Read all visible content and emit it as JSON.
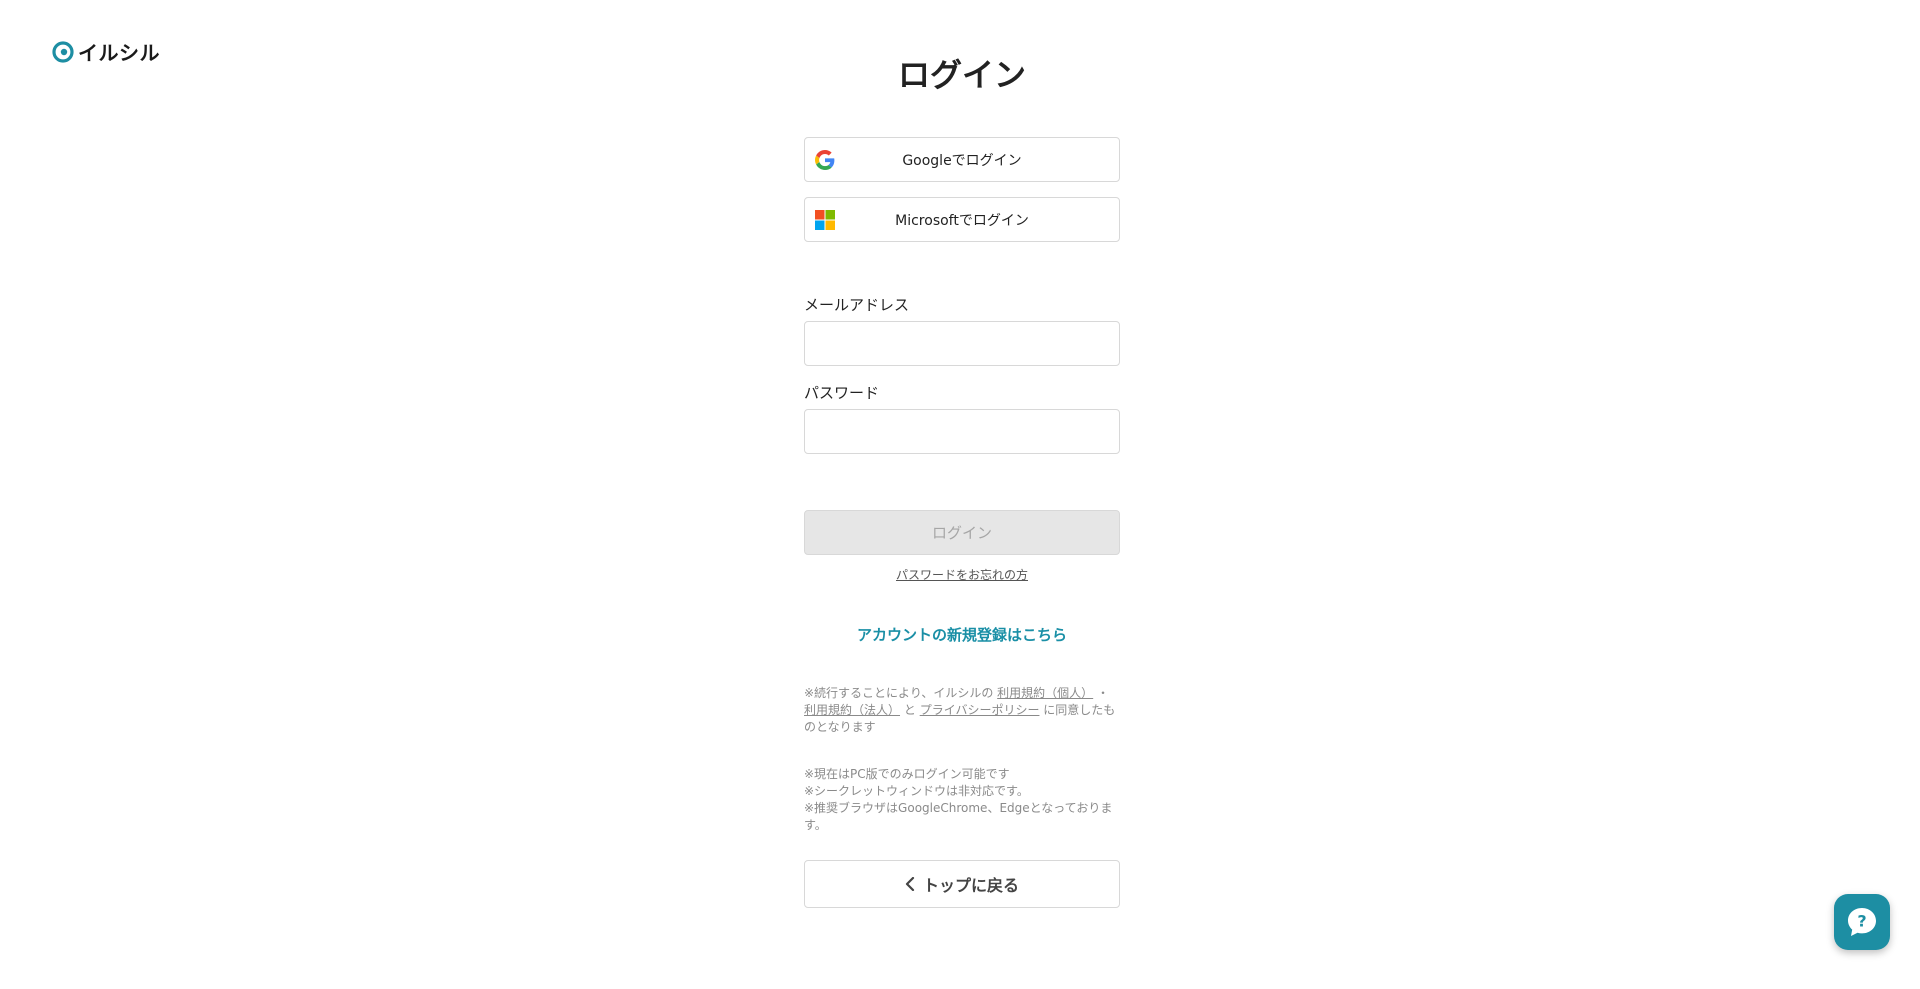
{
  "logo": {
    "text": "イルシル"
  },
  "page": {
    "title": "ログイン"
  },
  "sso": {
    "google_label": "Googleでログイン",
    "microsoft_label": "Microsoftでログイン"
  },
  "form": {
    "email_label": "メールアドレス",
    "email_value": "",
    "password_label": "パスワード",
    "password_value": "",
    "login_label": "ログイン",
    "forgot_label": "パスワードをお忘れの方"
  },
  "signup": {
    "label": "アカウントの新規登録はこちら"
  },
  "terms": {
    "prefix": "※続行することにより、イルシルの",
    "terms_personal": "利用規約（個人）",
    "sep": "・",
    "terms_corporate": "利用規約（法人）",
    "and": "と",
    "privacy": "プライバシーポリシー",
    "suffix": "に同意したものとなります"
  },
  "notes": [
    "※現在はPC版でのみログイン可能です",
    "※シークレットウィンドウは非対応です。",
    "※推奨ブラウザはGoogleChrome、Edgeとなっております。"
  ],
  "back": {
    "label": "トップに戻る"
  },
  "colors": {
    "accent": "#1a8fa6",
    "fab": "#1d8ea3",
    "disabled_bg": "#e6e6e6",
    "disabled_text": "#a6a6a6"
  }
}
